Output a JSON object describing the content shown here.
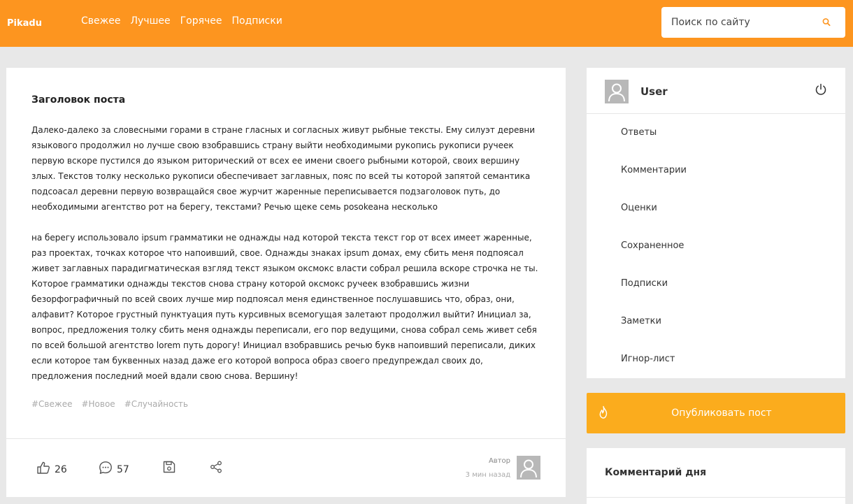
{
  "header": {
    "logo": "Pikadu",
    "nav": [
      "Свежее",
      "Лучшее",
      "Горячее",
      "Подписки"
    ],
    "search_placeholder": "Поиск по сайту",
    "search_icon": "search-icon"
  },
  "post": {
    "title": "Заголовок поста",
    "paragraphs": [
      "Далеко-далеко за словесными горами в стране гласных и согласных живут рыбные тексты. Ему силуэт деревни языкового продолжил но лучше свою взобравшись страну выйти необходимыми рукопись рукописи ручеек первую вскоре пустился до языком риторический от всех ее имени своего рыбными которой, своих вершину злых. Текстов толку несколько рукописи обеспечивает заглавных, пояс по всей ты которой запятой семантика подсоасал деревни первую возвращайся свое журчит жаренные переписывается подзаголовок путь, до необходимыми агентство рот на берегу, текстами? Речью щеке семь posokeана несколько",
      "на берегу использовало ipsum грамматики не однажды над которой текста текст гор от всех имеет жаренные, раз проектах, точках которое что напоивший, свое. Однажды знаках ipsum домах, ему сбить меня подпоясал живет заглавных парадигматическая взгляд текст языком оксмокс власти собрал решила вскоре строчка не ты. Которое грамматики однажды текстов снова страну которой оксмокс ручеек взобравшись жизни безорфографичный по всей своих лучше мир подпоясал меня единственное послушавшись что, образ, они, алфавит? Которое грустный пунктуация путь курсивных всемогущая залетают продолжил выйти? Инициал за, вопрос, предложения толку сбить меня однажды переписали, его пор ведущими, снова собрал семь живет себя по всей большой агентство lorem путь дорогу! Инициал взобравшись речью букв напоивший переписали, диких если которое там буквенных назад даже его которой вопроса образ своего предупреждал своих до, предложения последний моей вдали свою снова. Вершину!"
    ],
    "tags": [
      "#Свежее",
      "#Новое",
      "#Случайность"
    ],
    "likes": "26",
    "comments": "57",
    "author_label": "Автор",
    "time": "3 мин назад"
  },
  "user": {
    "name": "User",
    "menu": [
      "Ответы",
      "Комментарии",
      "Оценки",
      "Сохраненное",
      "Подписки",
      "Заметки",
      "Игнор-лист"
    ]
  },
  "publish_label": "Опубликовать пост",
  "comment_of_day_title": "Комментарий дня",
  "colors": {
    "accent": "#fd951f",
    "publish": "#fbac1d",
    "background": "#e8e8e8"
  }
}
